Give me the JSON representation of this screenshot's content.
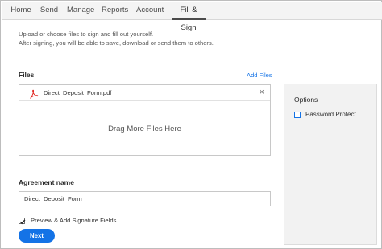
{
  "nav": {
    "tabs": [
      {
        "label": "Home",
        "active": false
      },
      {
        "label": "Send",
        "active": false
      },
      {
        "label": "Manage",
        "active": false
      },
      {
        "label": "Reports",
        "active": false
      },
      {
        "label": "Account",
        "active": false
      },
      {
        "label": "Fill & Sign",
        "active": true
      }
    ]
  },
  "intro": {
    "line1": "Upload or choose files to sign and fill out yourself.",
    "line2": "After signing, you will be able to save, download or send them to others."
  },
  "files": {
    "label": "Files",
    "add_files_label": "Add Files",
    "items": [
      {
        "name": "Direct_Deposit_Form.pdf",
        "icon": "pdf-icon"
      }
    ],
    "drop_text": "Drag More Files Here"
  },
  "options": {
    "title": "Options",
    "password_protect_label": "Password Protect",
    "password_protect_checked": false
  },
  "agreement": {
    "label": "Agreement name",
    "value": "Direct_Deposit_Form"
  },
  "preview": {
    "label": "Preview & Add Signature Fields",
    "checked": true
  },
  "next_label": "Next",
  "colors": {
    "accent": "#1473e6",
    "pdf_red": "#e0201b",
    "nav_bg": "#f4f4f4",
    "options_bg": "#f2f2f2"
  }
}
